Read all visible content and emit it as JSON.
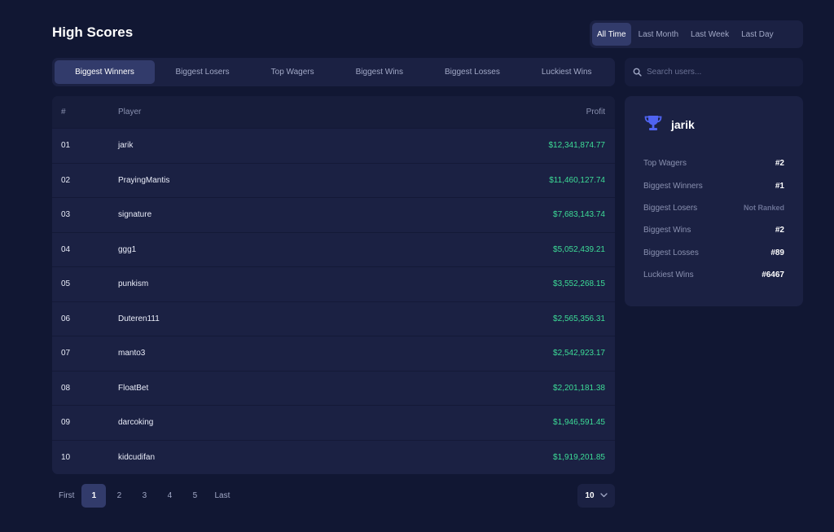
{
  "header": {
    "title": "High Scores"
  },
  "time_filters": [
    {
      "label": "All Time",
      "active": true
    },
    {
      "label": "Last Month",
      "active": false
    },
    {
      "label": "Last Week",
      "active": false
    },
    {
      "label": "Last Day",
      "active": false
    }
  ],
  "category_tabs": [
    {
      "label": "Biggest Winners",
      "active": true
    },
    {
      "label": "Biggest Losers",
      "active": false
    },
    {
      "label": "Top Wagers",
      "active": false
    },
    {
      "label": "Biggest Wins",
      "active": false
    },
    {
      "label": "Biggest Losses",
      "active": false
    },
    {
      "label": "Luckiest Wins",
      "active": false
    }
  ],
  "search": {
    "placeholder": "Search users...",
    "icon": "search-icon"
  },
  "table": {
    "columns": {
      "rank": "#",
      "player": "Player",
      "profit": "Profit"
    },
    "rows": [
      {
        "rank": "01",
        "player": "jarik",
        "profit": "$12,341,874.77"
      },
      {
        "rank": "02",
        "player": "PrayingMantis",
        "profit": "$11,460,127.74"
      },
      {
        "rank": "03",
        "player": "signature",
        "profit": "$7,683,143.74"
      },
      {
        "rank": "04",
        "player": "ggg1",
        "profit": "$5,052,439.21"
      },
      {
        "rank": "05",
        "player": "punkism",
        "profit": "$3,552,268.15"
      },
      {
        "rank": "06",
        "player": "Duteren111",
        "profit": "$2,565,356.31"
      },
      {
        "rank": "07",
        "player": "manto3",
        "profit": "$2,542,923.17"
      },
      {
        "rank": "08",
        "player": "FloatBet",
        "profit": "$2,201,181.38"
      },
      {
        "rank": "09",
        "player": "darcoking",
        "profit": "$1,946,591.45"
      },
      {
        "rank": "10",
        "player": "kidcudifan",
        "profit": "$1,919,201.85"
      }
    ]
  },
  "pagination": {
    "first_label": "First",
    "pages": [
      "1",
      "2",
      "3",
      "4",
      "5"
    ],
    "current_page": "1",
    "last_label": "Last",
    "per_page": "10"
  },
  "user_card": {
    "icon": "trophy-icon",
    "name": "jarik",
    "stats": [
      {
        "label": "Top Wagers",
        "value": "#2"
      },
      {
        "label": "Biggest Winners",
        "value": "#1"
      },
      {
        "label": "Biggest Losers",
        "value": "Not Ranked"
      },
      {
        "label": "Biggest Wins",
        "value": "#2"
      },
      {
        "label": "Biggest Losses",
        "value": "#89"
      },
      {
        "label": "Luckiest Wins",
        "value": "#6467"
      }
    ]
  },
  "colors": {
    "background": "#111733",
    "panel": "#1b2143",
    "active": "#323b6b",
    "profit_green": "#3ddc97",
    "trophy_blue": "#4f63f0"
  }
}
